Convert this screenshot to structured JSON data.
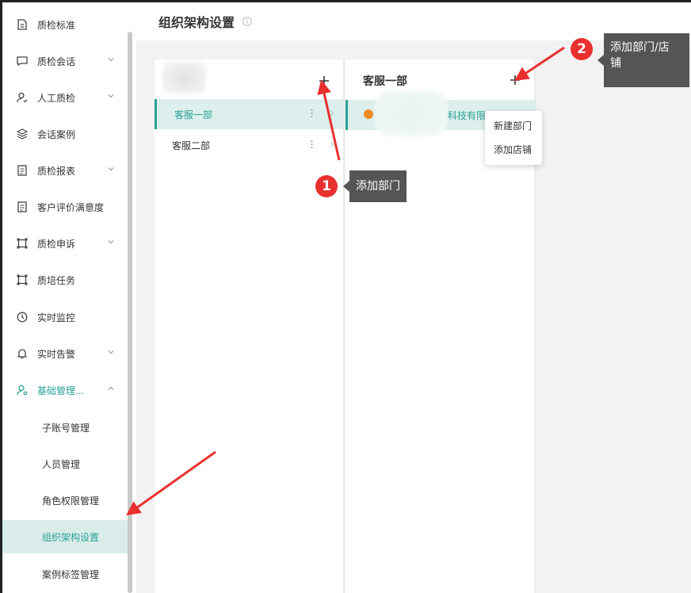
{
  "page": {
    "title": "组织架构设置"
  },
  "sidebar": {
    "items": [
      {
        "label": "质检标准",
        "icon": "file-icon",
        "has_chevron": false
      },
      {
        "label": "质检会话",
        "icon": "chat-icon",
        "has_chevron": true
      },
      {
        "label": "人工质检",
        "icon": "user-check-icon",
        "has_chevron": true
      },
      {
        "label": "会话案例",
        "icon": "layers-icon",
        "has_chevron": false
      },
      {
        "label": "质检报表",
        "icon": "report-icon",
        "has_chevron": true
      },
      {
        "label": "客户评价满意度",
        "icon": "report-icon",
        "has_chevron": false
      },
      {
        "label": "质检申诉",
        "icon": "frame-icon",
        "has_chevron": true
      },
      {
        "label": "质培任务",
        "icon": "frame-icon",
        "has_chevron": false
      },
      {
        "label": "实时监控",
        "icon": "clock-icon",
        "has_chevron": false
      },
      {
        "label": "实时告警",
        "icon": "bell-icon",
        "has_chevron": true
      },
      {
        "label": "基础管理...",
        "icon": "user-settings-icon",
        "has_chevron": true,
        "expanded": true
      }
    ],
    "sub_items": [
      {
        "label": "子账号管理"
      },
      {
        "label": "人员管理"
      },
      {
        "label": "角色权限管理"
      },
      {
        "label": "组织架构设置",
        "active": true
      },
      {
        "label": "案例标签管理"
      }
    ]
  },
  "departments": {
    "items": [
      {
        "label": "客服一部",
        "active": true
      },
      {
        "label": "客服二部",
        "active": false
      }
    ]
  },
  "detail": {
    "title": "客服一部",
    "store_name": "科技有限公司"
  },
  "add_menu": {
    "options": [
      "新建部门",
      "添加店铺"
    ]
  },
  "annotations": {
    "one": {
      "number": "1",
      "text": "添加部门"
    },
    "two": {
      "number": "2",
      "text": "添加部门/店\n铺"
    }
  },
  "colors": {
    "accent": "#2aa198",
    "active_bg": "#dcefec",
    "badge": "#e8312f",
    "tooltip": "#555555",
    "arrow": "#e8312f"
  }
}
